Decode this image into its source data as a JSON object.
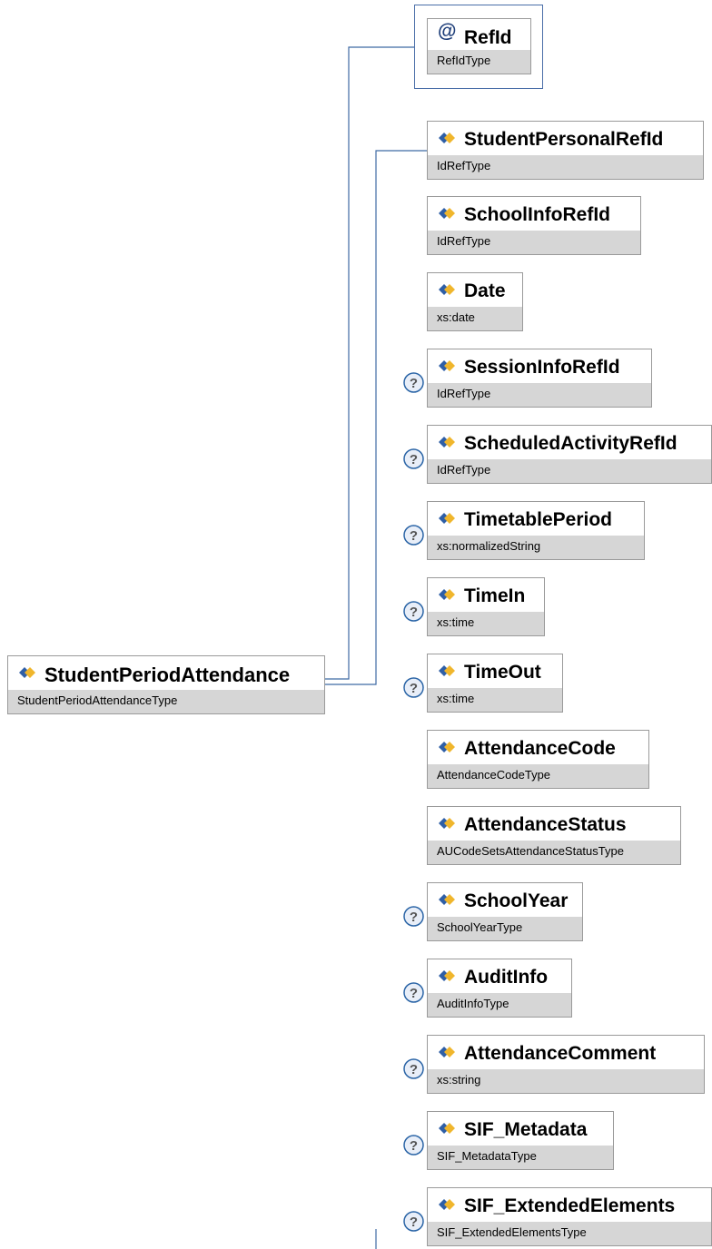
{
  "root": {
    "name": "StudentPeriodAttendance",
    "type": "StudentPeriodAttendanceType"
  },
  "attribute": {
    "symbol": "@",
    "name": "RefId",
    "type": "RefIdType"
  },
  "elements": [
    {
      "name": "StudentPersonalRefId",
      "type": "IdRefType",
      "optional": false
    },
    {
      "name": "SchoolInfoRefId",
      "type": "IdRefType",
      "optional": false
    },
    {
      "name": "Date",
      "type": "xs:date",
      "optional": false
    },
    {
      "name": "SessionInfoRefId",
      "type": "IdRefType",
      "optional": true
    },
    {
      "name": "ScheduledActivityRefId",
      "type": "IdRefType",
      "optional": true
    },
    {
      "name": "TimetablePeriod",
      "type": "xs:normalizedString",
      "optional": true
    },
    {
      "name": "TimeIn",
      "type": "xs:time",
      "optional": true
    },
    {
      "name": "TimeOut",
      "type": "xs:time",
      "optional": true
    },
    {
      "name": "AttendanceCode",
      "type": "AttendanceCodeType",
      "optional": false
    },
    {
      "name": "AttendanceStatus",
      "type": "AUCodeSetsAttendanceStatusType",
      "optional": false
    },
    {
      "name": "SchoolYear",
      "type": "SchoolYearType",
      "optional": true
    },
    {
      "name": "AuditInfo",
      "type": "AuditInfoType",
      "optional": true
    },
    {
      "name": "AttendanceComment",
      "type": "xs:string",
      "optional": true
    },
    {
      "name": "SIF_Metadata",
      "type": "SIF_MetadataType",
      "optional": true
    },
    {
      "name": "SIF_ExtendedElements",
      "type": "SIF_ExtendedElementsType",
      "optional": true
    }
  ],
  "colors": {
    "connector": "#3f6aa3",
    "type_bar": "#d6d6d6",
    "border": "#9a9a9a",
    "optional_icon": "#2a64a6"
  },
  "icons": {
    "element": "element-diamond-icon",
    "optional": "question-mark-icon",
    "attribute": "at-sign-icon"
  }
}
